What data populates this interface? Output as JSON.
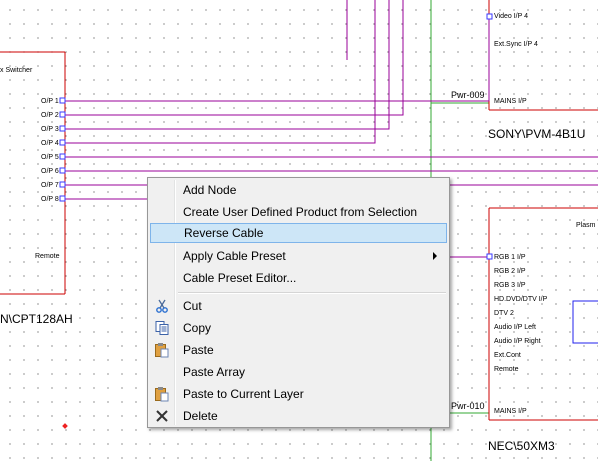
{
  "switcher": {
    "title": "x Switcher",
    "outputs": [
      "O/P 1",
      "O/P 2",
      "O/P 3",
      "O/P 4",
      "O/P 5",
      "O/P 6",
      "O/P 7",
      "O/P 8"
    ],
    "remote": "Remote",
    "name": "N\\CPT128AH"
  },
  "monitor": {
    "ports": [
      "Video I/P 4",
      "Ext.Sync I/P 4"
    ],
    "power_label": "Pwr-009",
    "mains": "MAINS I/P",
    "name": "SONY\\PVM-4B1U"
  },
  "plasma": {
    "title": "Plasm",
    "ports": [
      "RGB 1 I/P",
      "RGB 2 I/P",
      "RGB 3 I/P",
      "HD.DVD/DTV I/P",
      "DTV 2",
      "Audio I/P Left",
      "Audio I/P Right",
      "Ext.Cont",
      "Remote"
    ],
    "power_label": "Pwr-010",
    "mains": "MAINS I/P",
    "name": "NEC\\50XM3"
  },
  "context_menu": {
    "items": [
      {
        "label": "Add Node",
        "icon": ""
      },
      {
        "label": "Create User Defined Product from Selection",
        "icon": ""
      },
      {
        "label": "Reverse Cable",
        "icon": "",
        "selected": true
      },
      {
        "label": "Apply Cable Preset",
        "icon": "",
        "submenu": true
      },
      {
        "label": "Cable Preset Editor...",
        "icon": ""
      },
      {
        "label": "Cut",
        "icon": "scissors-icon"
      },
      {
        "label": "Copy",
        "icon": "copy-icon"
      },
      {
        "label": "Paste",
        "icon": "paste-icon"
      },
      {
        "label": "Paste Array",
        "icon": ""
      },
      {
        "label": "Paste to Current Layer",
        "icon": "paste-layer-icon"
      },
      {
        "label": "Delete",
        "icon": "delete-icon"
      }
    ]
  },
  "colors": {
    "cable": "#990099",
    "power": "#33aa33",
    "block": "#cc0000",
    "port": "#3a3aff"
  }
}
